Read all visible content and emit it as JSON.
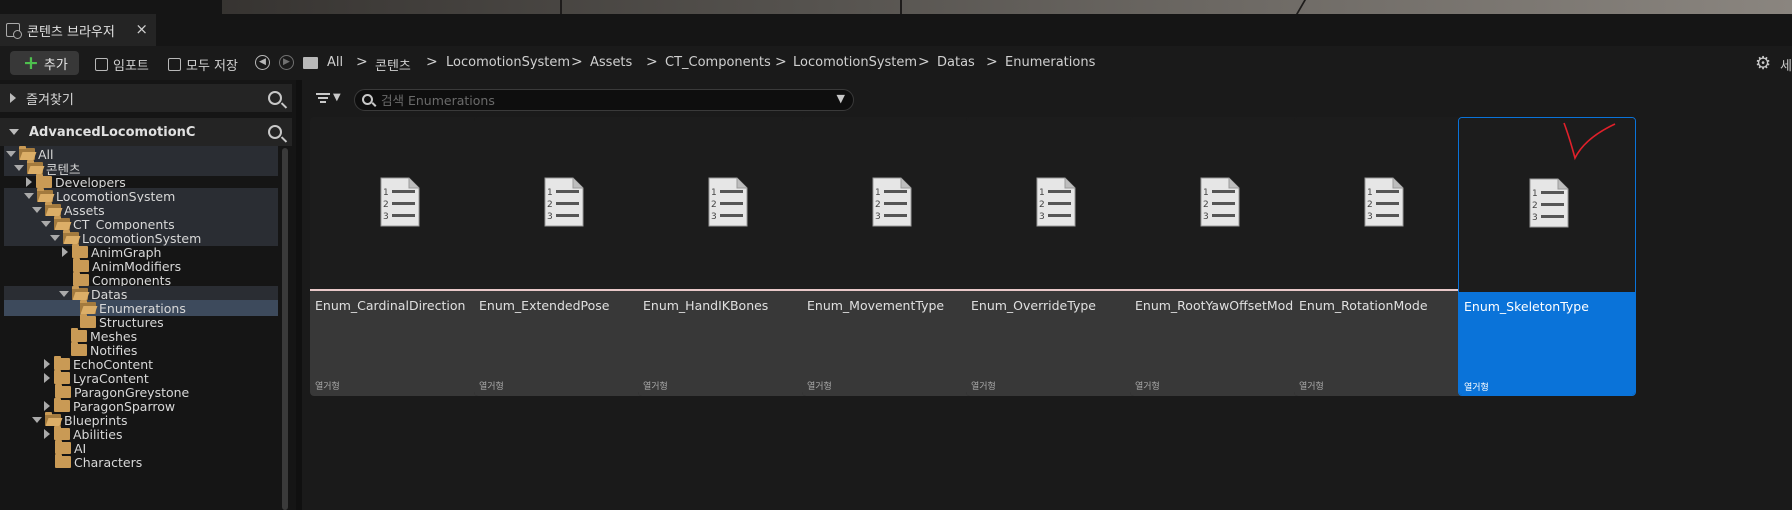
{
  "tab": {
    "label": "콘텐츠 브라우저",
    "close": "×"
  },
  "toolbar": {
    "add_label": "추가",
    "import_label": "임포트",
    "save_all_label": "모두 저장",
    "settings_label": "세"
  },
  "breadcrumbs": [
    "All",
    "콘텐츠",
    "LocomotionSystem",
    "Assets",
    "CT_Components",
    "LocomotionSystem",
    "Datas",
    "Enumerations"
  ],
  "crumb_separator": ">",
  "sidebar": {
    "favorites_label": "즐겨찾기",
    "project_label": "AdvancedLocomotionC",
    "tree": [
      {
        "label": "All"
      },
      {
        "label": "콘텐츠"
      },
      {
        "label": "Developers"
      },
      {
        "label": "LocomotionSystem"
      },
      {
        "label": "Assets"
      },
      {
        "label": "CT_Components"
      },
      {
        "label": "LocomotionSystem"
      },
      {
        "label": "AnimGraph"
      },
      {
        "label": "AnimModifiers"
      },
      {
        "label": "Components"
      },
      {
        "label": "Datas"
      },
      {
        "label": "Enumerations"
      },
      {
        "label": "Structures"
      },
      {
        "label": "Meshes"
      },
      {
        "label": "Notifies"
      },
      {
        "label": "EchoContent"
      },
      {
        "label": "LyraContent"
      },
      {
        "label": "ParagonGreystone"
      },
      {
        "label": "ParagonSparrow"
      },
      {
        "label": "Blueprints"
      },
      {
        "label": "Abilities"
      },
      {
        "label": "AI"
      },
      {
        "label": "Characters"
      }
    ]
  },
  "search": {
    "placeholder": "검색 Enumerations",
    "value": ""
  },
  "assets": [
    {
      "name": "Enum_CardinalDirection",
      "type": "열거형"
    },
    {
      "name": "Enum_ExtendedPose",
      "type": "열거형"
    },
    {
      "name": "Enum_HandIKBones",
      "type": "열거형"
    },
    {
      "name": "Enum_MovementType",
      "type": "열거형"
    },
    {
      "name": "Enum_OverrideType",
      "type": "열거형"
    },
    {
      "name": "Enum_RootYawOffsetMode",
      "type": "열거형"
    },
    {
      "name": "Enum_RotationMode",
      "type": "열거형"
    },
    {
      "name": "Enum_SkeletonType",
      "type": "열거형",
      "selected": true
    }
  ],
  "colors": {
    "selection": "#0a73d9",
    "folder": "#c99a55",
    "add_icon": "#4ec04e",
    "annotation": "#e0202a"
  }
}
